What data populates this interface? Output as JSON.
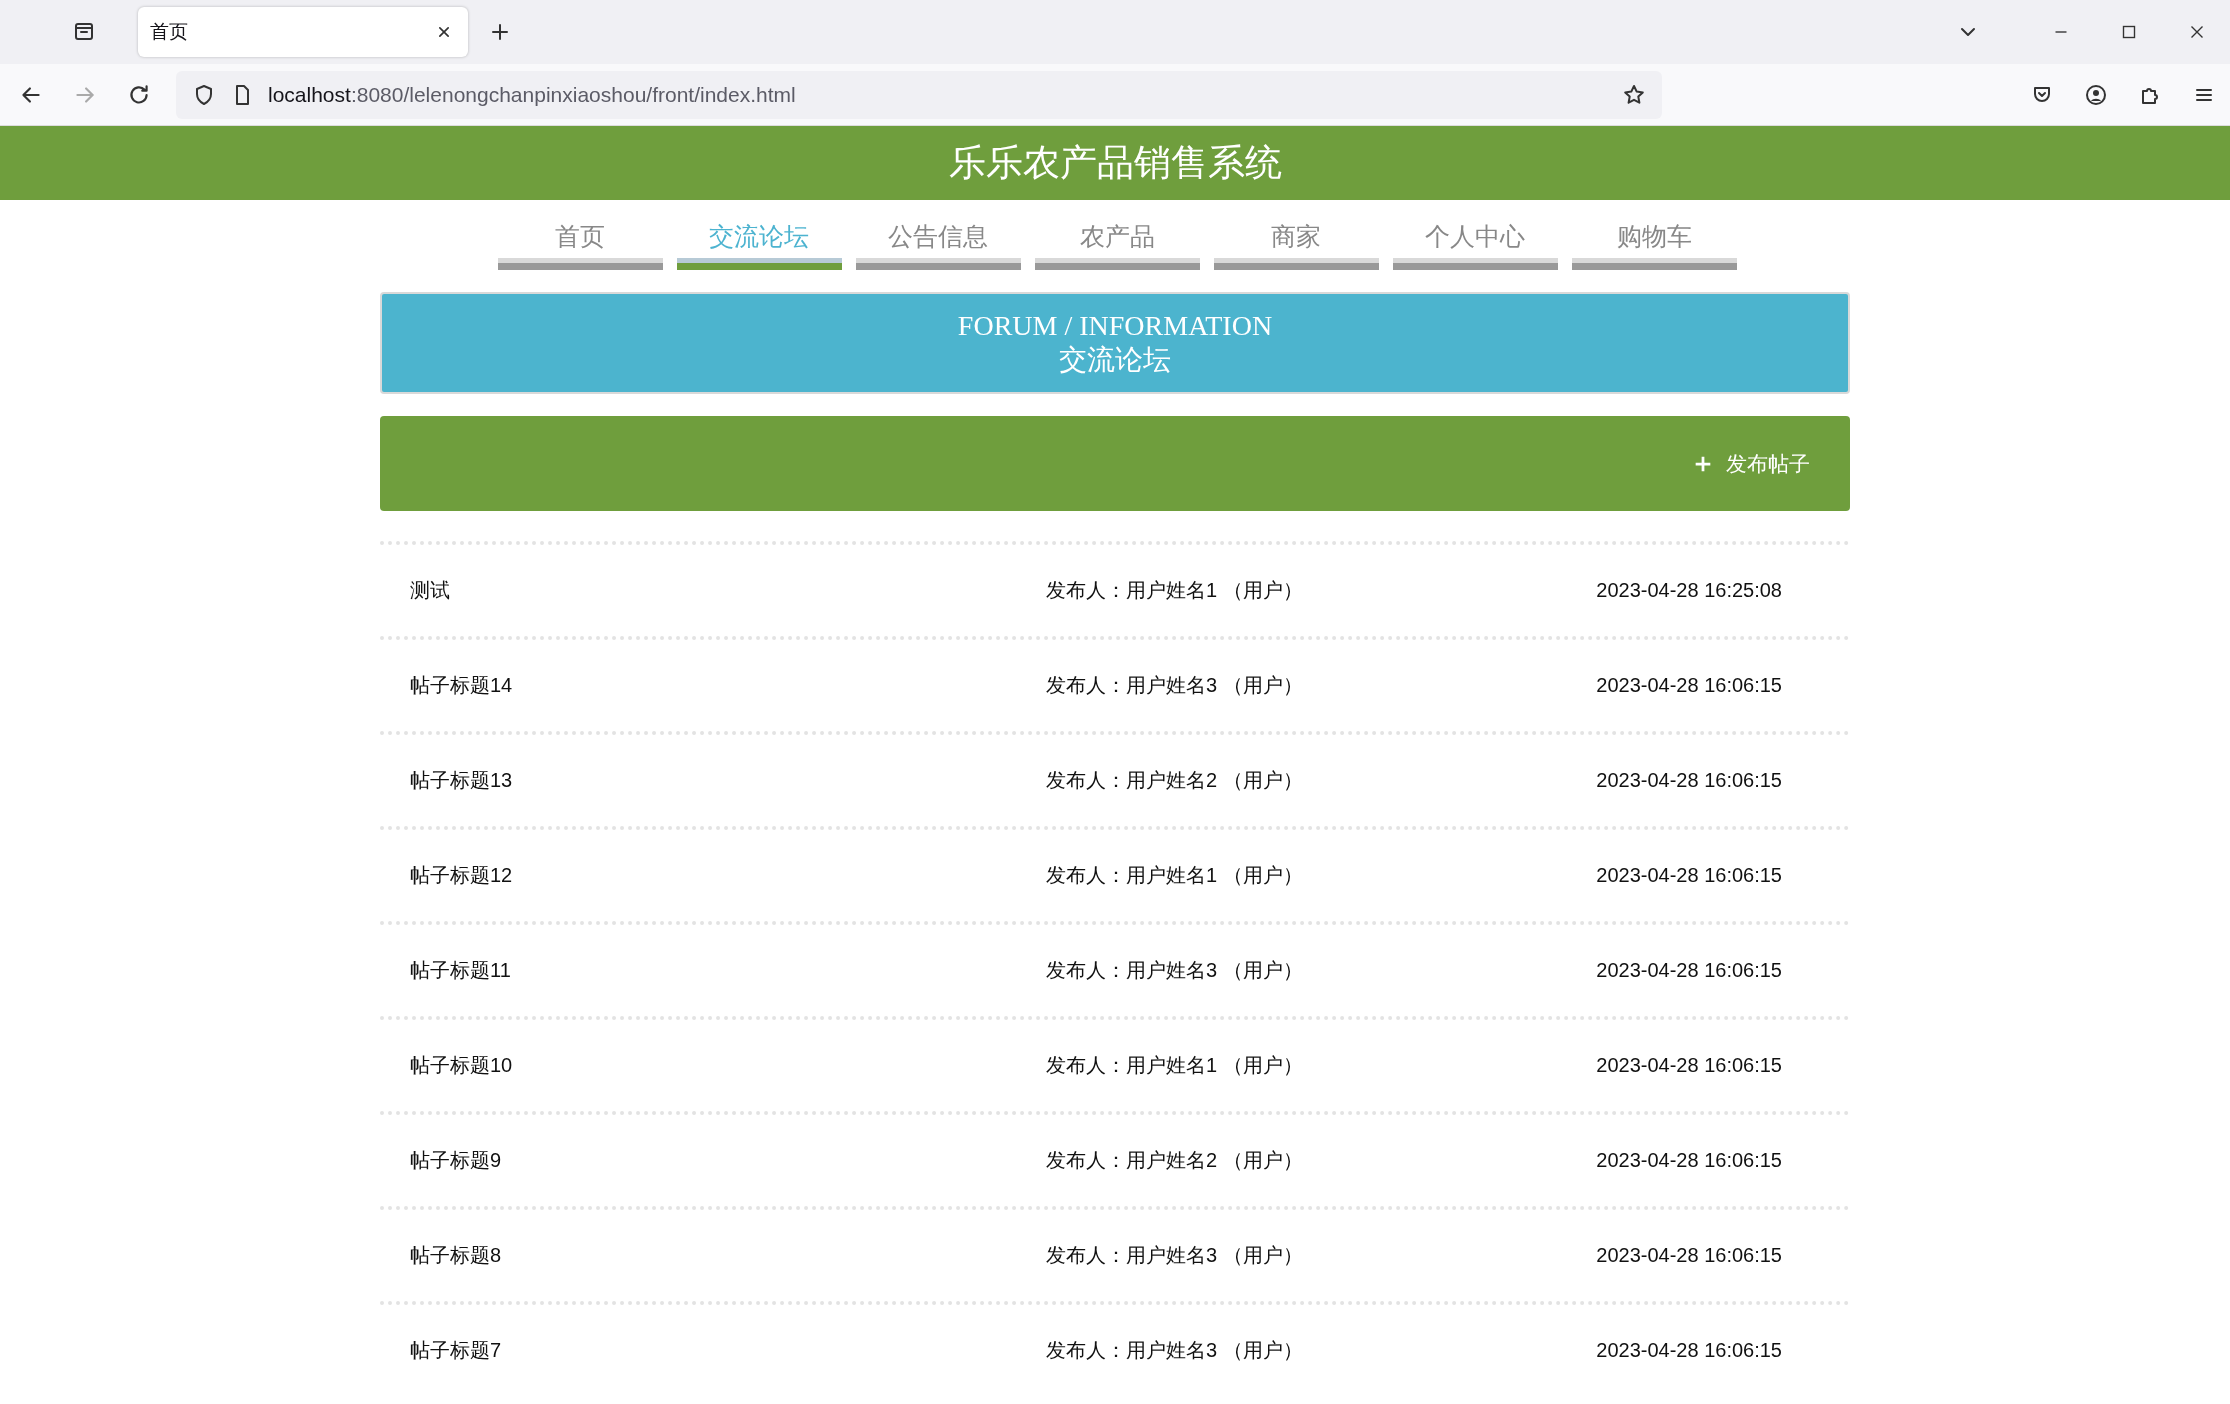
{
  "browser": {
    "tab_title": "首页",
    "url_host": "localhost",
    "url_rest": ":8080/lelenongchanpinxiaoshou/front/index.html"
  },
  "site_title": "乐乐农产品销售系统",
  "nav": [
    {
      "label": "首页",
      "selected": false
    },
    {
      "label": "交流论坛",
      "selected": true
    },
    {
      "label": "公告信息",
      "selected": false
    },
    {
      "label": "农产品",
      "selected": false
    },
    {
      "label": "商家",
      "selected": false
    },
    {
      "label": "个人中心",
      "selected": false
    },
    {
      "label": "购物车",
      "selected": false
    }
  ],
  "banner": {
    "title": "FORUM / INFORMATION",
    "subtitle": "交流论坛"
  },
  "post_button": {
    "label": "发布帖子"
  },
  "posts": [
    {
      "title": "测试",
      "author": "发布人：用户姓名1 （用户）",
      "time": "2023-04-28 16:25:08"
    },
    {
      "title": "帖子标题14",
      "author": "发布人：用户姓名3 （用户）",
      "time": "2023-04-28 16:06:15"
    },
    {
      "title": "帖子标题13",
      "author": "发布人：用户姓名2 （用户）",
      "time": "2023-04-28 16:06:15"
    },
    {
      "title": "帖子标题12",
      "author": "发布人：用户姓名1 （用户）",
      "time": "2023-04-28 16:06:15"
    },
    {
      "title": "帖子标题11",
      "author": "发布人：用户姓名3 （用户）",
      "time": "2023-04-28 16:06:15"
    },
    {
      "title": "帖子标题10",
      "author": "发布人：用户姓名1 （用户）",
      "time": "2023-04-28 16:06:15"
    },
    {
      "title": "帖子标题9",
      "author": "发布人：用户姓名2 （用户）",
      "time": "2023-04-28 16:06:15"
    },
    {
      "title": "帖子标题8",
      "author": "发布人：用户姓名3 （用户）",
      "time": "2023-04-28 16:06:15"
    },
    {
      "title": "帖子标题7",
      "author": "发布人：用户姓名3 （用户）",
      "time": "2023-04-28 16:06:15"
    }
  ]
}
